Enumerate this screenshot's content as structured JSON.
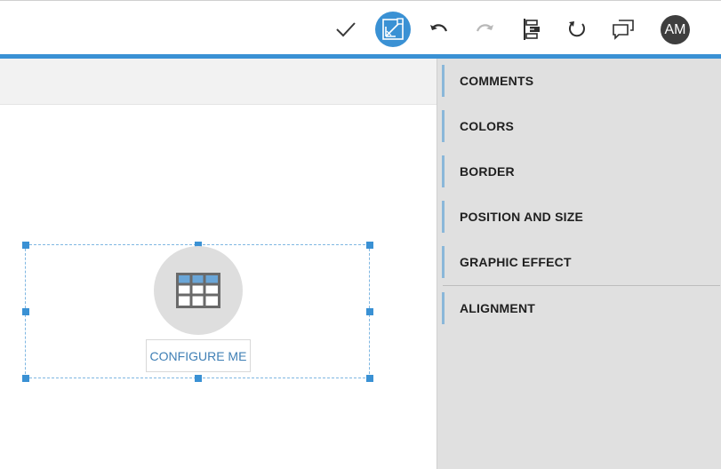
{
  "toolbar": {
    "confirm_icon": "checkmark-icon",
    "design_mode_icon": "design-mode-icon",
    "undo_icon": "undo-icon",
    "redo_icon": "redo-icon",
    "align_icon": "align-panel-icon",
    "refresh_icon": "refresh-icon",
    "comments_icon": "comments-icon",
    "avatar_initials": "AM",
    "accent_color": "#3a91d4"
  },
  "widget": {
    "icon": "table-grid-icon",
    "configure_label": "CONFIGURE ME"
  },
  "panel": {
    "items": [
      {
        "label": "COMMENTS"
      },
      {
        "label": "COLORS"
      },
      {
        "label": "BORDER"
      },
      {
        "label": "POSITION AND SIZE"
      },
      {
        "label": "GRAPHIC EFFECT"
      },
      {
        "label": "ALIGNMENT"
      }
    ]
  }
}
